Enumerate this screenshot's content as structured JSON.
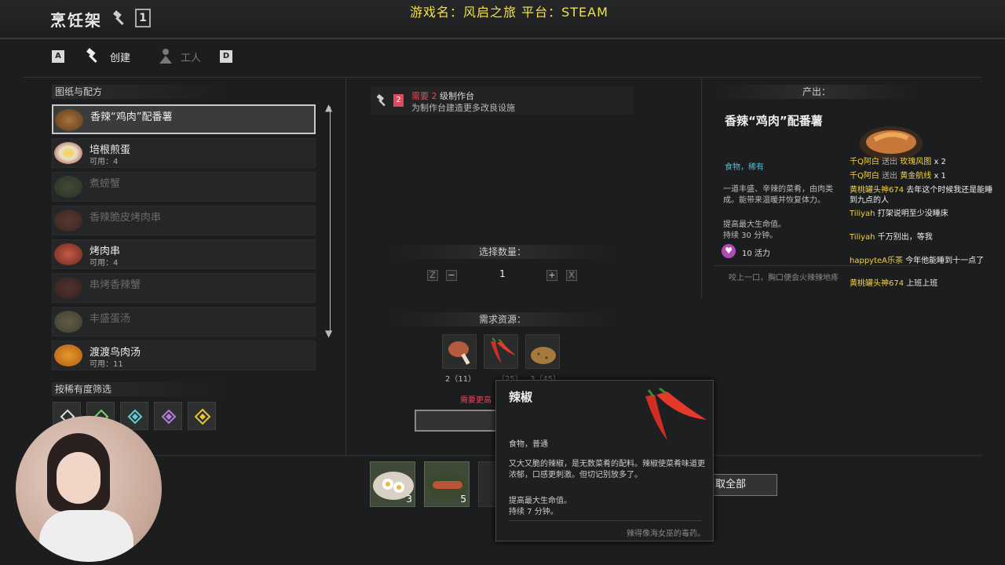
{
  "header": {
    "title": "烹饪架",
    "level_badge": "1",
    "caption": "游戏名：风启之旅 平台：STEAM"
  },
  "tabs": {
    "key_left": "A",
    "create": "创建",
    "worker": "工人",
    "key_right": "D"
  },
  "recipes_panel": {
    "heading": "图纸与配方",
    "items": [
      {
        "name": "香辣“鸡肉”配番薯",
        "available": "",
        "state": "selected"
      },
      {
        "name": "培根煎蛋",
        "available": "可用：4",
        "state": "normal"
      },
      {
        "name": "煮螃蟹",
        "available": "",
        "state": "locked"
      },
      {
        "name": "香辣脆皮烤肉串",
        "available": "",
        "state": "locked"
      },
      {
        "name": "烤肉串",
        "available": "可用：4",
        "state": "normal"
      },
      {
        "name": "串烤香辣蟹",
        "available": "",
        "state": "locked"
      },
      {
        "name": "丰盛蛋汤",
        "available": "",
        "state": "locked"
      },
      {
        "name": "渡渡鸟肉汤",
        "available": "可用：11",
        "state": "normal"
      }
    ]
  },
  "filter": {
    "heading": "按稀有度筛选"
  },
  "requirement": {
    "need": "需要",
    "level": "2",
    "rest": "级制作台",
    "hint": "为制作台建造更多改良设施",
    "badge": "2"
  },
  "quantity": {
    "heading": "选择数量：",
    "key_left": "Z",
    "minus": "−",
    "value": "1",
    "plus": "+",
    "key_right": "X"
  },
  "resources": {
    "heading": "需求资源：",
    "items": [
      {
        "name": "drumstick",
        "label": "2（11）"
      },
      {
        "name": "chili",
        "label": "（25）"
      },
      {
        "name": "potato",
        "label": "3（45）"
      }
    ],
    "warning": "需要更高"
  },
  "output": {
    "heading": "产出：",
    "name": "香辣“鸡肉”配番薯",
    "tags": "食物，稀有",
    "desc": "一道丰盛、辛辣的菜肴，由肉类成。能带来温暖并恢复体力。",
    "effect1": "提高最大生命值。",
    "effect2": "持续 30 分钟。",
    "vitality": "10 活力",
    "flavor": "咬上一口，胸口便会火辣辣地疼"
  },
  "tooltip": {
    "name": "辣椒",
    "tags": "食物，普通",
    "desc": "又大又脆的辣椒，是无数菜肴的配料。辣椒使菜肴味道更浓郁，口感更刺激。但切记别放多了。",
    "effect1": "提高最大生命值。",
    "effect2": "持续 7 分钟。",
    "flavor": "辣得像海女巫的毒药。"
  },
  "bottom": {
    "items": [
      {
        "count": "3"
      },
      {
        "count": "5"
      }
    ],
    "take_all": "取全部"
  },
  "chat": [
    {
      "user": "千Q阿白",
      "action": "送出",
      "gift": "玫瑰风图",
      "qty": "x 2"
    },
    {
      "user": "千Q阿白",
      "action": "送出",
      "gift": "黄金航线",
      "qty": "x 1"
    },
    {
      "user": "黄桃罐头神674",
      "msg": "去年这个时候我还是能睡到九点的人"
    },
    {
      "user": "Tiliyah",
      "msg": "打架说明至少没睡床"
    },
    {
      "user": "Tiliyah",
      "msg": "千万别出，等我"
    },
    {
      "user": "happyteA乐茶",
      "msg": "今年他能睡到十一点了"
    },
    {
      "user": "黄桃罐头神674",
      "msg": "上班上班"
    }
  ],
  "colors": {
    "accent_red": "#e0495d",
    "caption_yellow": "#f1e04a",
    "chat_gold": "#f2d24a",
    "selected_border": "#c9c9c9"
  }
}
